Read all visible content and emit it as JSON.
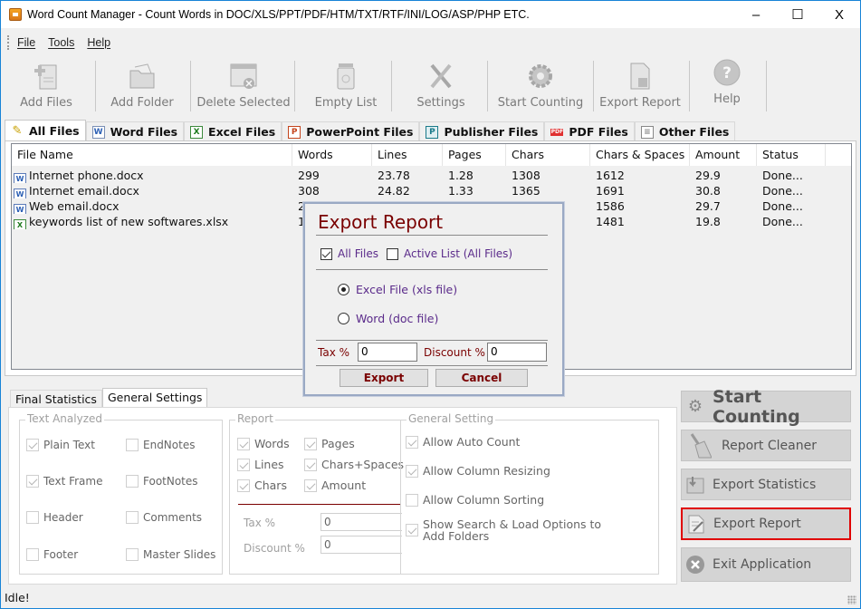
{
  "window": {
    "title": "Word Count Manager - Count Words in DOC/XLS/PPT/PDF/HTM/TXT/RTF/INI/LOG/ASP/PHP ETC.",
    "minimize": "–",
    "maximize": "☐",
    "close": "X"
  },
  "menu": [
    "File",
    "Tools",
    "Help"
  ],
  "toolbar": [
    {
      "label": "Add Files",
      "icon": "add-files-icon"
    },
    {
      "label": "Add Folder",
      "icon": "add-folder-icon"
    },
    {
      "label": "Delete Selected",
      "icon": "delete-selected-icon"
    },
    {
      "label": "Empty List",
      "icon": "empty-list-icon"
    },
    {
      "label": "Settings",
      "icon": "settings-icon"
    },
    {
      "label": "Start Counting",
      "icon": "gear-icon"
    },
    {
      "label": "Export Report",
      "icon": "export-report-icon"
    },
    {
      "label": "Help",
      "icon": "help-icon"
    }
  ],
  "file_tabs": [
    {
      "label": "All Files",
      "active": true
    },
    {
      "label": "Word Files"
    },
    {
      "label": "Excel Files"
    },
    {
      "label": "PowerPoint Files"
    },
    {
      "label": "Publisher Files"
    },
    {
      "label": "PDF Files"
    },
    {
      "label": "Other Files"
    }
  ],
  "table": {
    "columns": [
      "File Name",
      "Words",
      "Lines",
      "Pages",
      "Chars",
      "Chars & Spaces",
      "Amount",
      "Status"
    ],
    "rows": [
      {
        "type": "word",
        "name": "Internet phone.docx",
        "words": "299",
        "lines": "23.78",
        "pages": "1.28",
        "chars": "1308",
        "chars_spaces": "1612",
        "amount": "29.9",
        "status": "Done..."
      },
      {
        "type": "word",
        "name": "Internet email.docx",
        "words": "308",
        "lines": "24.82",
        "pages": "1.33",
        "chars": "1365",
        "chars_spaces": "1691",
        "amount": "30.8",
        "status": "Done..."
      },
      {
        "type": "word",
        "name": "Web email.docx",
        "words": "2",
        "lines": "",
        "pages": "",
        "chars": "",
        "chars_spaces": "1586",
        "amount": "29.7",
        "status": "Done..."
      },
      {
        "type": "excel",
        "name": "keywords list of new softwares.xlsx",
        "words": "1",
        "lines": "",
        "pages": "",
        "chars": "",
        "chars_spaces": "1481",
        "amount": "19.8",
        "status": "Done..."
      }
    ]
  },
  "dialog": {
    "title": "Export Report",
    "all_files": "All Files",
    "all_files_checked": true,
    "active_list": "Active List (All Files)",
    "active_list_checked": false,
    "format_excel": "Excel File (xls file)",
    "format_word": "Word (doc file)",
    "selected_format": "excel",
    "tax_label": "Tax %",
    "tax_value": "0",
    "discount_label": "Discount %",
    "discount_value": "0",
    "export_button": "Export",
    "cancel_button": "Cancel"
  },
  "bottom_tabs": [
    {
      "label": "Final Statistics"
    },
    {
      "label": "General Settings",
      "active": true
    }
  ],
  "settings": {
    "text_analyzed": {
      "title": "Text Analyzed",
      "items": [
        {
          "label": "Plain Text",
          "checked": true
        },
        {
          "label": "EndNotes",
          "checked": false
        },
        {
          "label": "Text Frame",
          "checked": true
        },
        {
          "label": "FootNotes",
          "checked": false
        },
        {
          "label": "Header",
          "checked": false
        },
        {
          "label": "Comments",
          "checked": false
        },
        {
          "label": "Footer",
          "checked": false
        },
        {
          "label": "Master Slides",
          "checked": false
        }
      ]
    },
    "report": {
      "title": "Report",
      "items": [
        {
          "label": "Words",
          "checked": true
        },
        {
          "label": "Pages",
          "checked": true
        },
        {
          "label": "Lines",
          "checked": true
        },
        {
          "label": "Chars+Spaces",
          "checked": true
        },
        {
          "label": "Chars",
          "checked": true
        },
        {
          "label": "Amount",
          "checked": true
        }
      ],
      "tax_label": "Tax %",
      "tax_value": "0",
      "discount_label": "Discount %",
      "discount_value": "0"
    },
    "general": {
      "title": "General Setting",
      "items": [
        {
          "label": "Allow Auto Count",
          "checked": true
        },
        {
          "label": "Allow Column Resizing",
          "checked": true
        },
        {
          "label": "Allow Column Sorting",
          "checked": false
        },
        {
          "label": "Show Search & Load Options to Add Folders",
          "checked": true
        }
      ]
    }
  },
  "side_buttons": [
    {
      "label": "Start Counting",
      "icon": "gear-icon"
    },
    {
      "label": "Report Cleaner",
      "icon": "broom-icon"
    },
    {
      "label": "Export Statistics",
      "icon": "export-statistics-icon"
    },
    {
      "label": "Export Report",
      "icon": "export-report-icon",
      "highlighted": true
    },
    {
      "label": "Exit Application",
      "icon": "exit-icon"
    }
  ],
  "status": "Idle!",
  "colors": {
    "dialog_title": "#7a0000",
    "dialog_option_text": "#5a2a8a",
    "highlight_border": "#e00000",
    "window_border": "#1883d7"
  }
}
